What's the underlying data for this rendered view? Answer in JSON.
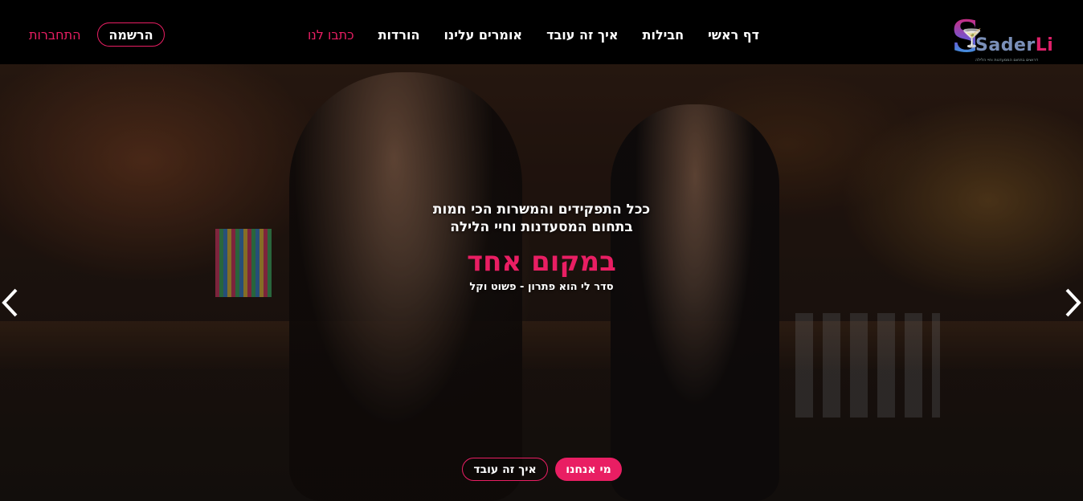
{
  "brand": {
    "logo_text_main": "Sader",
    "logo_text_accent": "Li",
    "tagline": "דרושים בתחום המסעדנות וחיי הלילה",
    "accent_color": "#e91e63",
    "logo_icon": "cocktail-glass-icon"
  },
  "nav": {
    "items": [
      {
        "label": "דף ראשי",
        "active": false
      },
      {
        "label": "חבילות",
        "active": false
      },
      {
        "label": "איך זה עובד",
        "active": false
      },
      {
        "label": "אומרים עלינו",
        "active": false
      },
      {
        "label": "הורדות",
        "active": false
      },
      {
        "label": "כתבו לנו",
        "active": true
      }
    ],
    "register_label": "הרשמה",
    "login_label": "התחברות"
  },
  "hero": {
    "line1": "ככל התפקידים והמשרות הכי חמות",
    "line2": "בתחום המסעדנות וחיי הלילה",
    "headline": "במקום אחד",
    "subtitle": "סדר לי הוא פתרון - פשוט וקל",
    "cta_primary": "מי אנחנו",
    "cta_secondary": "איך זה עובד",
    "prev_icon": "chevron-left-icon",
    "next_icon": "chevron-right-icon"
  }
}
